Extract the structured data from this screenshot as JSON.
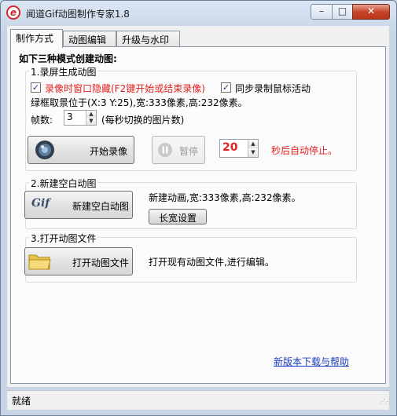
{
  "window": {
    "title": "闻道Gif动图制作专家1.8"
  },
  "tabs": [
    {
      "label": "制作方式"
    },
    {
      "label": "动图编辑"
    },
    {
      "label": "升级与水印"
    }
  ],
  "panel": {
    "heading": "如下三种模式创建动图:"
  },
  "record": {
    "group_label": "1.录屏生成动图",
    "hide_window_checked": true,
    "hide_window_label": "录像时窗口隐藏(F2键开始或结束录像)",
    "sync_mouse_checked": true,
    "sync_mouse_label": "同步录制鼠标活动",
    "frame_info": "绿框取景位于(X:3 Y:25),宽:333像素,高:232像素。",
    "fps_label": "帧数:",
    "fps_value": "3",
    "fps_hint": "(每秒切换的图片数)",
    "start_label": "开始录像",
    "pause_label": "暂停",
    "auto_stop_value": "20",
    "auto_stop_label": "秒后自动停止。"
  },
  "blank": {
    "group_label": "2.新建空白动图",
    "button_icon_text": "Gif",
    "button_label": "新建空白动图",
    "info": "新建动画,宽:333像素,高:232像素。",
    "size_button_label": "长宽设置"
  },
  "open": {
    "group_label": "3.打开动图文件",
    "button_label": "打开动图文件",
    "info": "打开现有动图文件,进行编辑。"
  },
  "link_label": "新版本下载与帮助",
  "status": {
    "text": "就绪"
  },
  "colors": {
    "accent_red": "#e02020",
    "link_blue": "#1a3cbf",
    "close_red": "#c8452b"
  }
}
